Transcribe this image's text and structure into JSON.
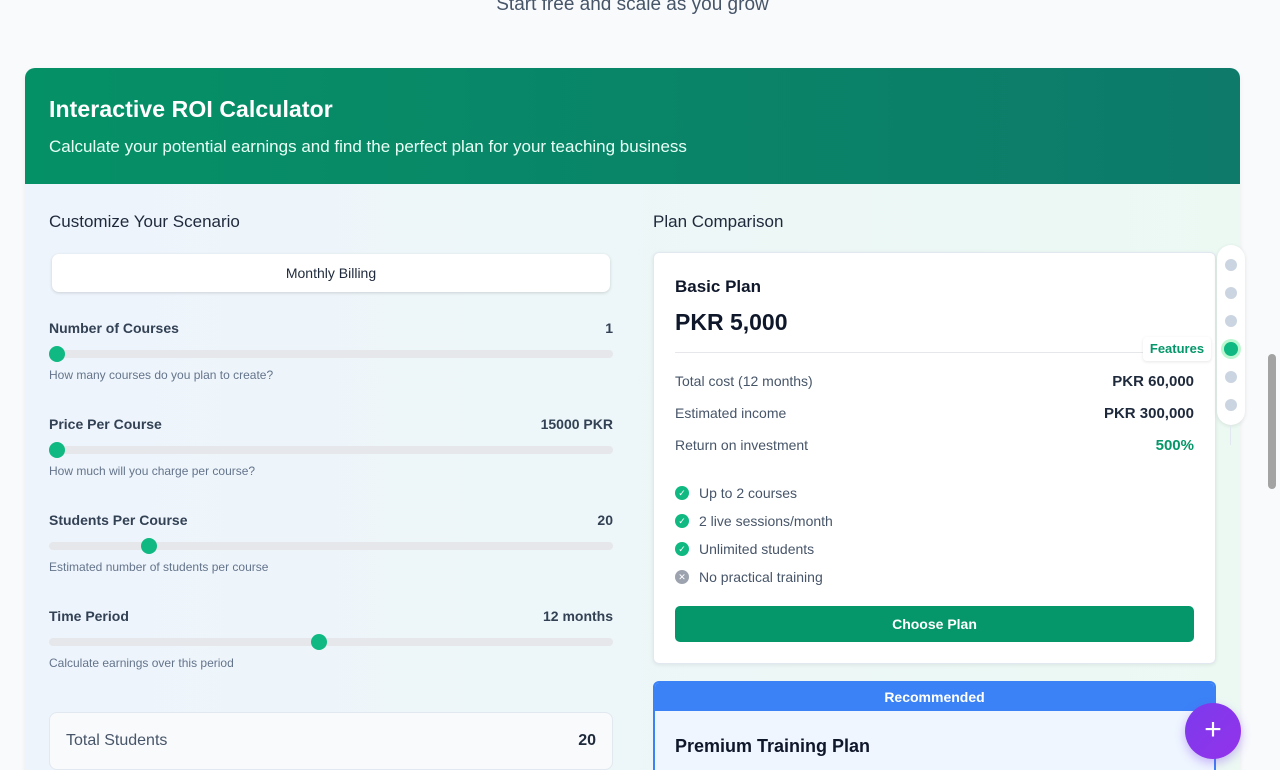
{
  "page": {
    "subtitle": "Start free and scale as you grow"
  },
  "hero": {
    "title": "Interactive ROI Calculator",
    "subtitle": "Calculate your potential earnings and find the perfect plan for your teaching business"
  },
  "scenario": {
    "title": "Customize Your Scenario",
    "billing_label": "Monthly Billing",
    "sliders": [
      {
        "label": "Number of Courses",
        "value": "1",
        "hint": "How many courses do you plan to create?",
        "level": 0.0
      },
      {
        "label": "Price Per Course",
        "value": "15000 PKR",
        "hint": "How much will you charge per course?",
        "level": 0.0
      },
      {
        "label": "Students Per Course",
        "value": "20",
        "hint": "Estimated number of students per course",
        "level": 0.167
      },
      {
        "label": "Time Period",
        "value": "12 months",
        "hint": "Calculate earnings over this period",
        "level": 0.478
      }
    ],
    "total_students": {
      "label": "Total Students",
      "value": "20"
    }
  },
  "comparison": {
    "title": "Plan Comparison",
    "basic": {
      "name": "Basic Plan",
      "price": "PKR 5,000",
      "rows": [
        {
          "label": "Total cost (12 months)",
          "value": "PKR 60,000"
        },
        {
          "label": "Estimated income",
          "value": "PKR 300,000"
        },
        {
          "label": "Return on investment",
          "value": "500%"
        }
      ],
      "features": [
        {
          "text": "Up to 2 courses",
          "included": true
        },
        {
          "text": "2 live sessions/month",
          "included": true
        },
        {
          "text": "Unlimited students",
          "included": true
        },
        {
          "text": "No practical training",
          "included": false
        }
      ],
      "cta": "Choose Plan"
    },
    "premium": {
      "badge": "Recommended",
      "name": "Premium Training Plan"
    }
  },
  "stepper": {
    "active_label": "Features",
    "active_index": 3,
    "count": 6
  },
  "colors": {
    "brand": "#059669",
    "accent": "#10b981",
    "recommended": "#3b82f6",
    "fab": "#7c3aed"
  },
  "icons": {
    "fab": "plus-icon",
    "check": "check-circle-icon",
    "cross": "x-circle-icon"
  }
}
